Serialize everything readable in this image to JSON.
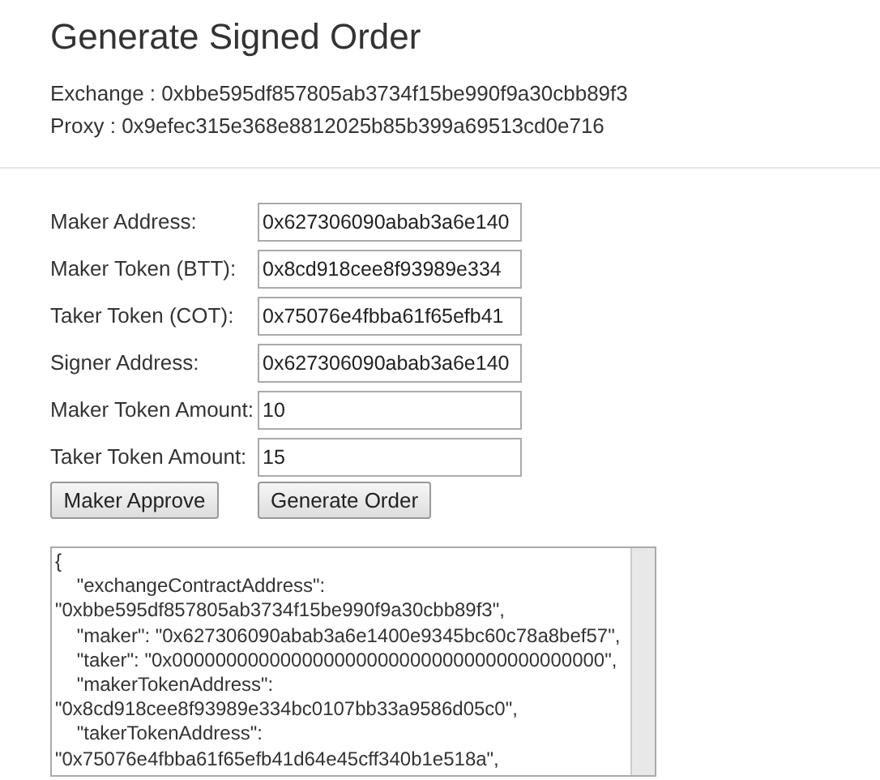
{
  "title": "Generate Signed Order",
  "info": [
    {
      "label": "Exchange :",
      "value": "0xbbe595df857805ab3734f15be990f9a30cbb89f3"
    },
    {
      "label": "Proxy :",
      "value": "0x9efec315e368e8812025b85b399a69513cd0e716"
    }
  ],
  "fields": [
    {
      "label": "Maker Address:",
      "value": "0x627306090abab3a6e140"
    },
    {
      "label": "Maker Token (BTT):",
      "value": "0x8cd918cee8f93989e334"
    },
    {
      "label": "Taker Token (COT):",
      "value": "0x75076e4fbba61f65efb41"
    },
    {
      "label": "Signer Address:",
      "value": "0x627306090abab3a6e140"
    },
    {
      "label": "Maker Token Amount:",
      "value": "10"
    },
    {
      "label": "Taker Token Amount:",
      "value": "15"
    }
  ],
  "buttons": [
    "Maker Approve",
    "Generate Order"
  ],
  "output": "{\n    \"exchangeContractAddress\": \"0xbbe595df857805ab3734f15be990f9a30cbb89f3\",\n    \"maker\": \"0x627306090abab3a6e1400e9345bc60c78a8bef57\",\n    \"taker\": \"0x0000000000000000000000000000000000000000\",\n    \"makerTokenAddress\": \"0x8cd918cee8f93989e334bc0107bb33a9586d05c0\",\n    \"takerTokenAddress\": \"0x75076e4fbba61f65efb41d64e45cff340b1e518a\","
}
